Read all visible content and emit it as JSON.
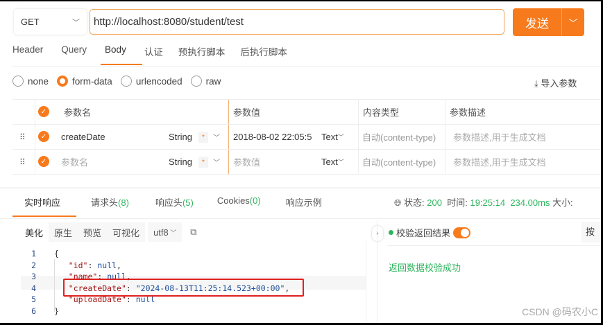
{
  "request": {
    "method": "GET",
    "url": "http://localhost:8080/student/test",
    "send_label": "发送"
  },
  "tabs": [
    "Header",
    "Query",
    "Body",
    "认证",
    "预执行脚本",
    "后执行脚本"
  ],
  "active_tab": "Body",
  "body_types": [
    "none",
    "form-data",
    "urlencoded",
    "raw"
  ],
  "selected_body_type": "form-data",
  "import_label": "导入参数",
  "table": {
    "headers": [
      "参数名",
      "参数值",
      "内容类型",
      "参数描述"
    ],
    "rows": [
      {
        "name": "createDate",
        "type": "String",
        "required": "*",
        "value": "2018-08-02 22:05:5",
        "value_type": "Text",
        "content_type": "自动(content-type)",
        "desc": "参数描述,用于生成文档"
      },
      {
        "name": "参数名",
        "type": "String",
        "required": "*",
        "value": "参数值",
        "value_type": "Text",
        "content_type": "自动(content-type)",
        "desc": "参数描述,用于生成文档"
      }
    ]
  },
  "response": {
    "tabs": [
      {
        "label": "实时响应"
      },
      {
        "label": "请求头",
        "count": "(8)"
      },
      {
        "label": "响应头",
        "count": "(5)"
      },
      {
        "label": "Cookies",
        "count": "(0)"
      },
      {
        "label": "响应示例"
      }
    ],
    "status_label": "状态:",
    "status": "200",
    "time_label": "时间:",
    "time": "19:25:14",
    "duration": "234.00ms",
    "size_label": "大小:",
    "view_modes": [
      "美化",
      "原生",
      "预览",
      "可视化"
    ],
    "encoding": "utf8",
    "code_lines": [
      {
        "n": "1",
        "text": "{"
      },
      {
        "n": "2",
        "key": "\"id\"",
        "val": "null",
        "end": ","
      },
      {
        "n": "3",
        "key": "\"name\"",
        "val": "null",
        "end": ","
      },
      {
        "n": "4",
        "key": "\"createDate\"",
        "val": "\"2024-08-13T11:25:14.523+00:00\"",
        "end": ","
      },
      {
        "n": "5",
        "key": "\"uploadDate\"",
        "val": "null",
        "end": ""
      },
      {
        "n": "6",
        "text": "}"
      }
    ],
    "validate_label": "校验返回结果",
    "validate_result": "返回数据校验成功",
    "right_button": "按"
  },
  "watermark": "CSDN @码农小C",
  "colors": {
    "accent": "#f77a1c",
    "success": "#2db55d",
    "highlight_box": "#e02020"
  }
}
